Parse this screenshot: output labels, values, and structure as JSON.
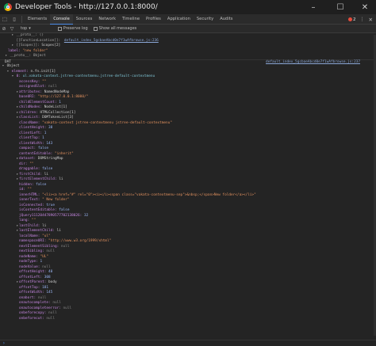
{
  "window": {
    "title": "Developer Tools - http://127.0.0.1:8000/",
    "minimize": "–",
    "maximize": "☐",
    "close": "✕"
  },
  "tabs": [
    {
      "label": "Elements",
      "active": false
    },
    {
      "label": "Console",
      "active": true
    },
    {
      "label": "Sources",
      "active": false
    },
    {
      "label": "Network",
      "active": false
    },
    {
      "label": "Timeline",
      "active": false
    },
    {
      "label": "Profiles",
      "active": false
    },
    {
      "label": "Application",
      "active": false
    },
    {
      "label": "Security",
      "active": false
    },
    {
      "label": "Audits",
      "active": false
    }
  ],
  "tabbar": {
    "error_count": "2"
  },
  "console_toolbar": {
    "context": "top",
    "preserve_log": "Preserve log",
    "show_all": "Show all messages"
  },
  "log": {
    "proto_line1": "__proto__: ()",
    "function_location_key": "[[FunctionLocation]]:",
    "function_location_link": "default_index_5gcbaeAbcd0e7f1wAfbrowse.js:236",
    "scopes_key": "[[Scopes]]:",
    "scopes_val": "Scopes[2]",
    "label_key": "label:",
    "label_val": "\"new folder\"",
    "proto_line2": "__proto__: Object",
    "dat_label": "DAT",
    "dat_link": "default_index_5gcbaeAbcd0e7f1wAfbrowse.js:237",
    "object_label": "Object",
    "element_key": "element:",
    "element_val": "n.fn.init[1]",
    "ul_key": "0:",
    "ul_val": "ul.vakata-context.jstree-contextmenu.jstree-default-contextmenu",
    "props": [
      {
        "t": "",
        "k": "accessKey:",
        "v": "\"\"",
        "c": "k-str"
      },
      {
        "t": "",
        "k": "assignedSlot:",
        "v": "null",
        "c": "k-null"
      },
      {
        "t": "▸",
        "k": "attributes:",
        "v": "NamedNodeMap",
        "c": "k-plain"
      },
      {
        "t": "",
        "k": "baseURI:",
        "v": "\"http://127.0.0.1:8000/\"",
        "c": "k-str"
      },
      {
        "t": "",
        "k": "childElementCount:",
        "v": "1",
        "c": "k-num"
      },
      {
        "t": "▸",
        "k": "childNodes:",
        "v": "NodeList[1]",
        "c": "k-plain"
      },
      {
        "t": "▸",
        "k": "children:",
        "v": "HTMLCollection[1]",
        "c": "k-plain"
      },
      {
        "t": "▸",
        "k": "classList:",
        "v": "DOMTokenList[3]",
        "c": "k-plain"
      },
      {
        "t": "",
        "k": "className:",
        "v": "\"vakata-context jstree-contextmenu jstree-default-contextmenu\"",
        "c": "k-str"
      },
      {
        "t": "",
        "k": "clientHeight:",
        "v": "38",
        "c": "k-num"
      },
      {
        "t": "",
        "k": "clientLeft:",
        "v": "1",
        "c": "k-num"
      },
      {
        "t": "",
        "k": "clientTop:",
        "v": "1",
        "c": "k-num"
      },
      {
        "t": "",
        "k": "clientWidth:",
        "v": "143",
        "c": "k-num"
      },
      {
        "t": "",
        "k": "compact:",
        "v": "false",
        "c": "k-num"
      },
      {
        "t": "",
        "k": "contentEditable:",
        "v": "\"inherit\"",
        "c": "k-str"
      },
      {
        "t": "▸",
        "k": "dataset:",
        "v": "DOMStringMap",
        "c": "k-plain"
      },
      {
        "t": "",
        "k": "dir:",
        "v": "\"\"",
        "c": "k-str"
      },
      {
        "t": "",
        "k": "draggable:",
        "v": "false",
        "c": "k-num"
      },
      {
        "t": "▸",
        "k": "firstChild:",
        "v": "li",
        "c": "k-plain"
      },
      {
        "t": "▸",
        "k": "firstElementChild:",
        "v": "li",
        "c": "k-plain"
      },
      {
        "t": "",
        "k": "hidden:",
        "v": "false",
        "c": "k-num"
      },
      {
        "t": "",
        "k": "id:",
        "v": "\"\"",
        "c": "k-str"
      },
      {
        "t": "",
        "k": "innerHTML:",
        "v": "\"<li><a href=\"#\" rel=\"0\"><i></i><span class=\"vakata-contextmenu-sep\">&nbsp;</span>New folder</a></li>\"",
        "c": "k-str"
      },
      {
        "t": "",
        "k": "innerText:",
        "v": "\" New folder\"",
        "c": "k-str"
      },
      {
        "t": "",
        "k": "isConnected:",
        "v": "true",
        "c": "k-num"
      },
      {
        "t": "",
        "k": "isContentEditable:",
        "v": "false",
        "c": "k-num"
      },
      {
        "t": "",
        "k": "jQuery11120447890577702138026:",
        "v": "32",
        "c": "k-num"
      },
      {
        "t": "",
        "k": "lang:",
        "v": "\"\"",
        "c": "k-str"
      },
      {
        "t": "▸",
        "k": "lastChild:",
        "v": "li",
        "c": "k-plain"
      },
      {
        "t": "▸",
        "k": "lastElementChild:",
        "v": "li",
        "c": "k-plain"
      },
      {
        "t": "",
        "k": "localName:",
        "v": "\"ul\"",
        "c": "k-str"
      },
      {
        "t": "",
        "k": "namespaceURI:",
        "v": "\"http://www.w3.org/1999/xhtml\"",
        "c": "k-str"
      },
      {
        "t": "",
        "k": "nextElementSibling:",
        "v": "null",
        "c": "k-null"
      },
      {
        "t": "",
        "k": "nextSibling:",
        "v": "null",
        "c": "k-null"
      },
      {
        "t": "",
        "k": "nodeName:",
        "v": "\"UL\"",
        "c": "k-str"
      },
      {
        "t": "",
        "k": "nodeType:",
        "v": "1",
        "c": "k-num"
      },
      {
        "t": "",
        "k": "nodeValue:",
        "v": "null",
        "c": "k-null"
      },
      {
        "t": "",
        "k": "offsetHeight:",
        "v": "40",
        "c": "k-num"
      },
      {
        "t": "",
        "k": "offsetLeft:",
        "v": "308",
        "c": "k-num"
      },
      {
        "t": "▸",
        "k": "offsetParent:",
        "v": "body",
        "c": "k-plain"
      },
      {
        "t": "",
        "k": "offsetTop:",
        "v": "181",
        "c": "k-num"
      },
      {
        "t": "",
        "k": "offsetWidth:",
        "v": "145",
        "c": "k-num"
      },
      {
        "t": "",
        "k": "onabort:",
        "v": "null",
        "c": "k-null"
      },
      {
        "t": "",
        "k": "onautocomplete:",
        "v": "null",
        "c": "k-null"
      },
      {
        "t": "",
        "k": "onautocompleteerror:",
        "v": "null",
        "c": "k-null"
      },
      {
        "t": "",
        "k": "onbeforecopy:",
        "v": "null",
        "c": "k-null"
      },
      {
        "t": "",
        "k": "onbeforecut:",
        "v": "null",
        "c": "k-null"
      }
    ]
  }
}
